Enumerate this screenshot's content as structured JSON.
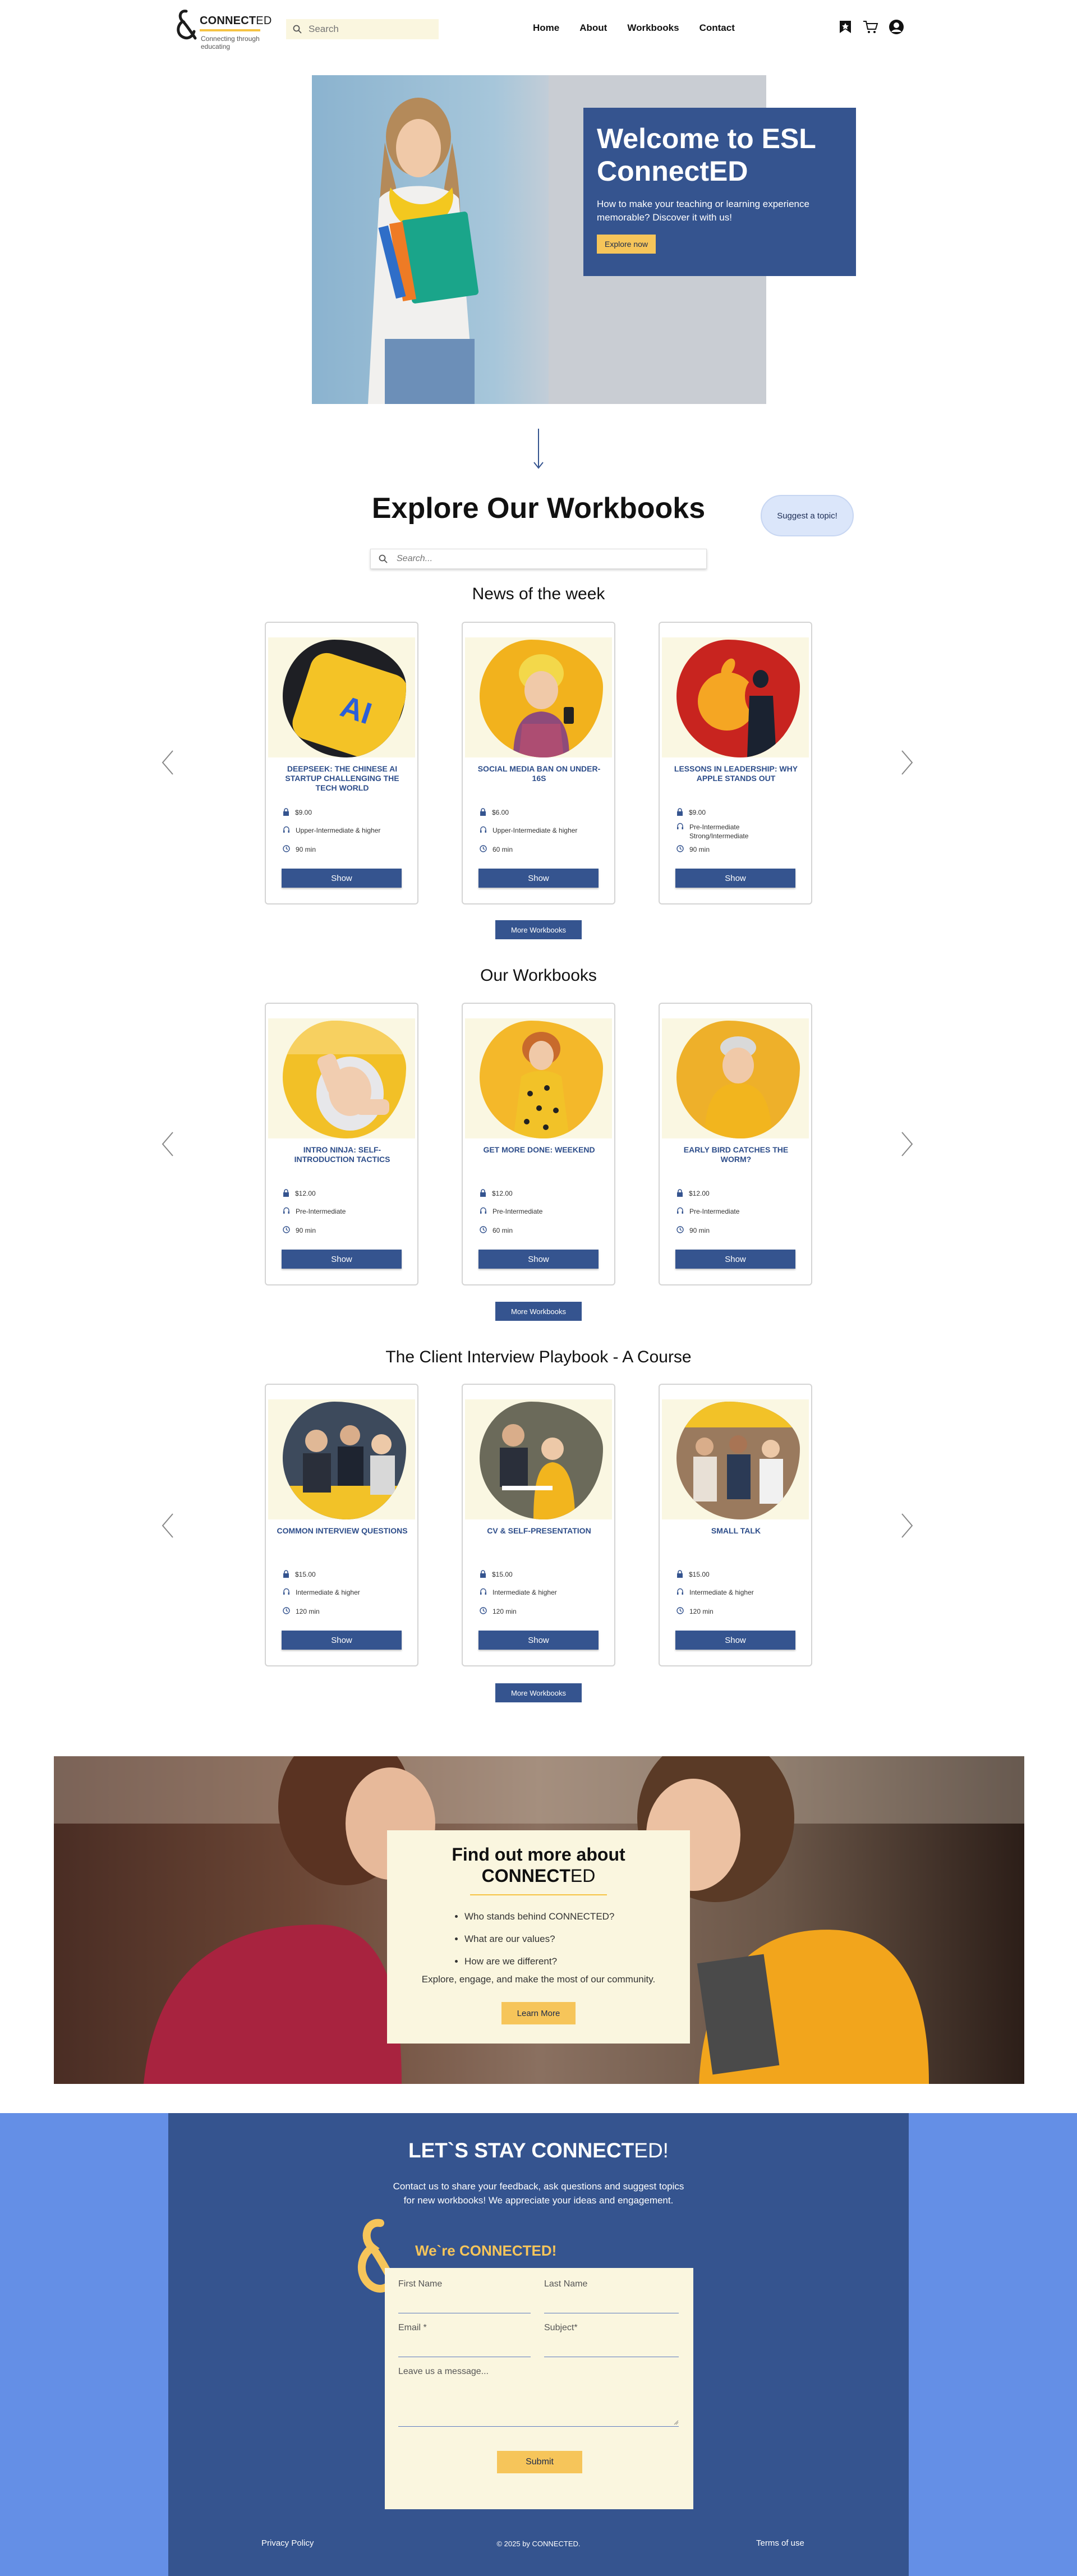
{
  "header": {
    "brand_main": "CONNECT",
    "brand_suffix": "ED",
    "tagline": "Connecting through educating",
    "search_placeholder": "Search",
    "nav": [
      "Home",
      "About",
      "Workbooks",
      "Contact"
    ],
    "icons": [
      "bookmark-icon",
      "cart-icon",
      "account-icon"
    ]
  },
  "hero": {
    "title": "Welcome to ESL ConnectED",
    "subtitle": "How to make your teaching or learning experience memorable? Discover it with us!",
    "cta": "Explore now"
  },
  "explore": {
    "title": "Explore Our Workbooks",
    "suggest_label": "Suggest a topic!",
    "search_placeholder": "Search..."
  },
  "sections": [
    {
      "title": "News of the week",
      "more_label": "More Workbooks",
      "cards": [
        {
          "title": "DEEPSEEK: THE CHINESE AI STARTUP CHALLENGING THE TECH WORLD",
          "price": "$9.00",
          "level": "Upper-Intermediate & higher",
          "duration": "90 min",
          "button": "Show",
          "color": "#f4c326"
        },
        {
          "title": "SOCIAL MEDIA BAN ON UNDER-16S",
          "price": "$6.00",
          "level": "Upper-Intermediate & higher",
          "duration": "60 min",
          "button": "Show",
          "color": "#f2b21d"
        },
        {
          "title": "LESSONS IN LEADERSHIP: WHY APPLE STANDS OUT",
          "price": "$9.00",
          "level": "Pre-Intermediate Strong/Intermediate",
          "duration": "90 min",
          "button": "Show",
          "color": "#c8241f"
        }
      ]
    },
    {
      "title": "Our Workbooks",
      "more_label": "More Workbooks",
      "cards": [
        {
          "title": "INTRO NINJA: SELF-INTRODUCTION TACTICS",
          "price": "$12.00",
          "level": "Pre-Intermediate",
          "duration": "90 min",
          "button": "Show",
          "color": "#f2c027"
        },
        {
          "title": "GET MORE DONE: WEEKEND",
          "price": "$12.00",
          "level": "Pre-Intermediate",
          "duration": "60 min",
          "button": "Show",
          "color": "#f4b82a"
        },
        {
          "title": "EARLY BIRD CATCHES THE WORM?",
          "price": "$12.00",
          "level": "Pre-Intermediate",
          "duration": "90 min",
          "button": "Show",
          "color": "#eeb02a"
        }
      ]
    },
    {
      "title": "The Client Interview Playbook - A Course",
      "more_label": "More Workbooks",
      "cards": [
        {
          "title": "COMMON INTERVIEW QUESTIONS",
          "price": "$15.00",
          "level": "Intermediate & higher",
          "duration": "120 min",
          "button": "Show",
          "color": "#3d4a5c"
        },
        {
          "title": "CV & SELF-PRESENTATION",
          "price": "$15.00",
          "level": "Intermediate & higher",
          "duration": "120 min",
          "button": "Show",
          "color": "#6b6a5a"
        },
        {
          "title": "SMALL TALK",
          "price": "$15.00",
          "level": "Intermediate & higher",
          "duration": "120 min",
          "button": "Show",
          "color": "#9a7a5e"
        }
      ]
    }
  ],
  "about": {
    "title_line1": "Find out more about",
    "title_brand_main": "CONNECT",
    "title_brand_suffix": "ED",
    "bullets": [
      "Who stands behind CONNECTED?",
      "What are our values?",
      "How are we different?"
    ],
    "closing": "Explore, engage, and make the most of our community.",
    "cta": "Learn More"
  },
  "contact": {
    "title_main": "LET`S STAY CONNECT",
    "title_suffix": "ED!",
    "description": "Contact us to share your feedback, ask questions and suggest topics for new workbooks! We appreciate your ideas and engagement.",
    "were_label": "We`re CONNECTED!",
    "first_name": "First Name",
    "last_name": "Last Name",
    "email": "Email *",
    "subject": "Subject*",
    "message": "Leave us a message...",
    "submit": "Submit"
  },
  "footer": {
    "privacy": "Privacy Policy",
    "copyright": "© 2025 by CONNECTED.",
    "terms": "Terms of use"
  },
  "colors": {
    "navy": "#35548f",
    "accent_yellow": "#f6c55a",
    "cream": "#faf6df",
    "contact_blue": "#648fe6"
  }
}
